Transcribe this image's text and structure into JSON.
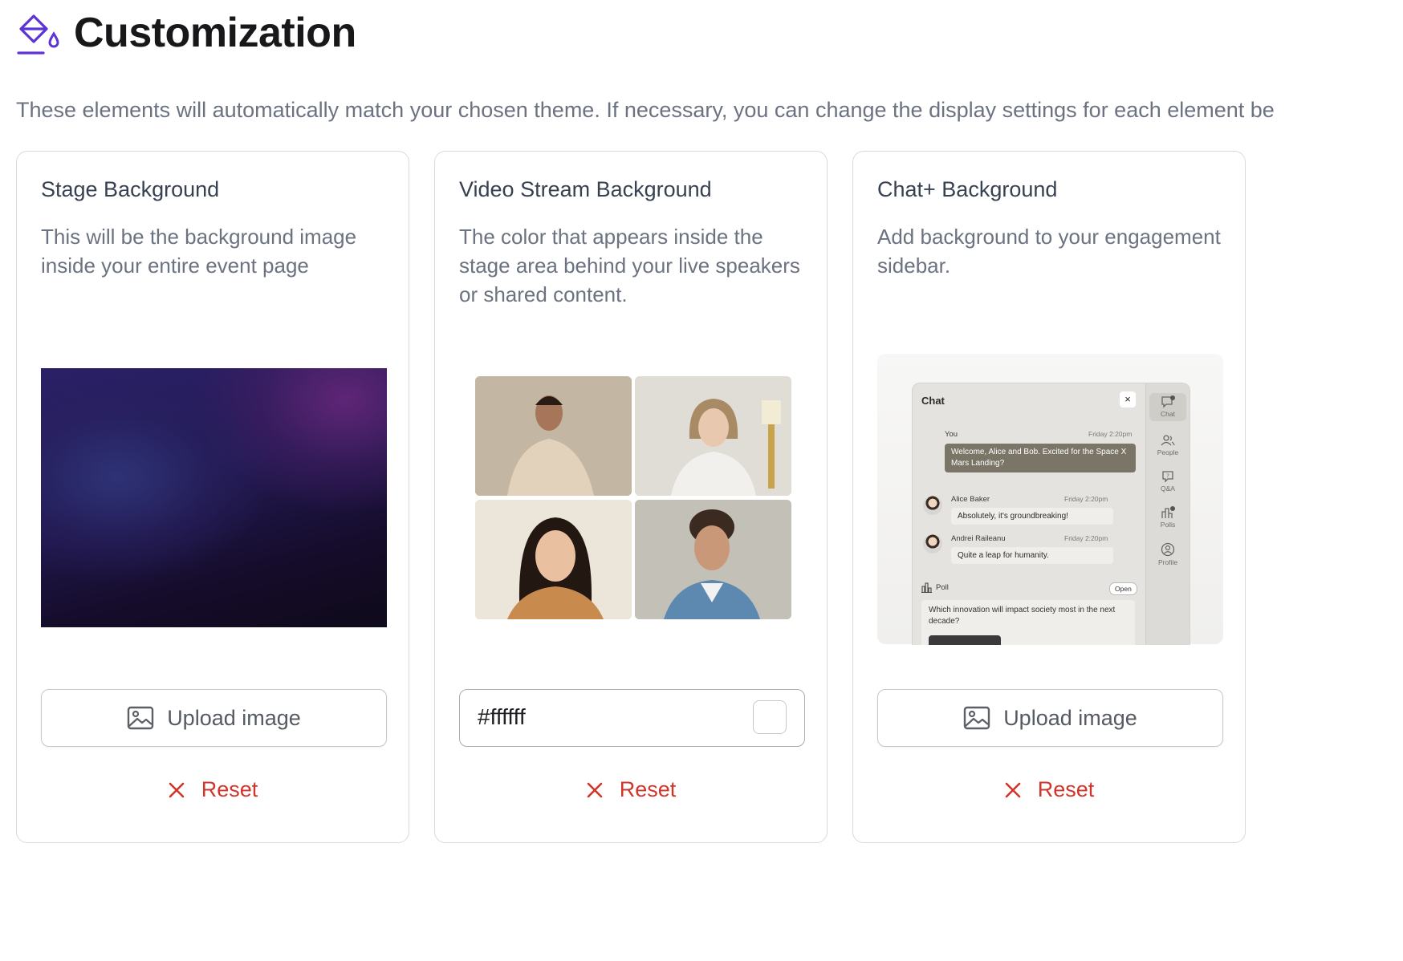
{
  "page": {
    "title": "Customization",
    "intro": "These elements will automatically match your chosen theme. If necessary, you can change the display settings for each element be",
    "accent_color": "#5b33d6"
  },
  "cards": [
    {
      "title": "Stage Background",
      "description": "This will be the background image inside your entire event page",
      "action_label": "Upload image",
      "reset_label": "Reset"
    },
    {
      "title": "Video Stream Background",
      "description": "The color that appears inside the stage area behind your live speakers or shared content.",
      "color_value": "#ffffff",
      "reset_label": "Reset"
    },
    {
      "title": "Chat+ Background",
      "description": "Add background to your engagement sidebar.",
      "action_label": "Upload image",
      "reset_label": "Reset",
      "preview": {
        "header": "Chat",
        "you_label": "You",
        "you_time": "Friday 2:20pm",
        "you_message": "Welcome, Alice and Bob. Excited for the Space X Mars Landing?",
        "messages": [
          {
            "name": "Alice Baker",
            "time": "Friday 2:20pm",
            "text": "Absolutely, it's groundbreaking!"
          },
          {
            "name": "Andrei Raileanu",
            "time": "Friday 2:20pm",
            "text": "Quite a leap for humanity."
          }
        ],
        "poll_label": "Poll",
        "poll_status": "Open",
        "poll_question": "Which innovation will impact society most in the next decade?",
        "sidebar": [
          {
            "label": "Chat",
            "icon": "chat-icon",
            "badge": "3"
          },
          {
            "label": "People",
            "icon": "people-icon"
          },
          {
            "label": "Q&A",
            "icon": "qa-icon"
          },
          {
            "label": "Polls",
            "icon": "polls-icon",
            "badge": "3"
          },
          {
            "label": "Profile",
            "icon": "profile-icon"
          }
        ]
      }
    }
  ]
}
